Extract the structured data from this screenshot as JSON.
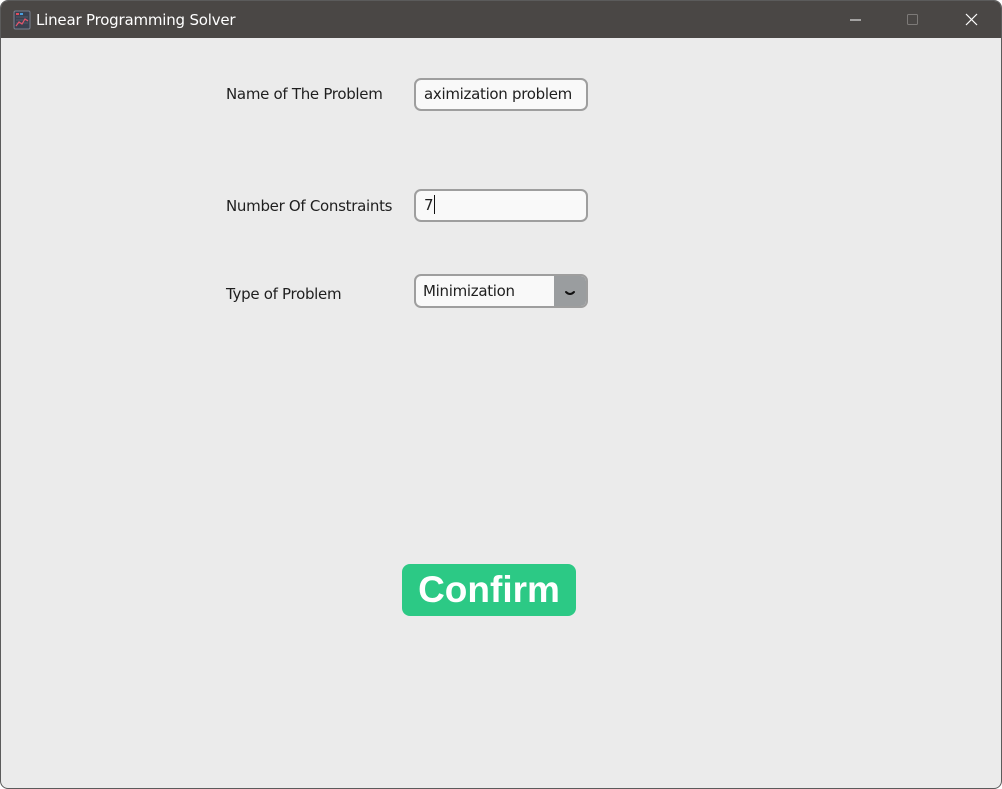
{
  "window": {
    "title": "Linear Programming Solver",
    "app_icon": "chart-app-icon",
    "controls": [
      "minimize-icon",
      "maximize-icon",
      "close-icon"
    ]
  },
  "form": {
    "name_label": "Name of The Problem",
    "name_value": "aximization problem",
    "constraints_label": "Number Of Constraints",
    "constraints_value": "7",
    "type_label": "Type of Problem",
    "type_value": "Minimization"
  },
  "actions": {
    "confirm_label": "Confirm"
  },
  "colors": {
    "titlebar": "#4a4745",
    "background": "#ebebeb",
    "accent": "#2cc985",
    "field_border": "#9e9e9e",
    "dropdown_button": "#9a9d9f"
  }
}
